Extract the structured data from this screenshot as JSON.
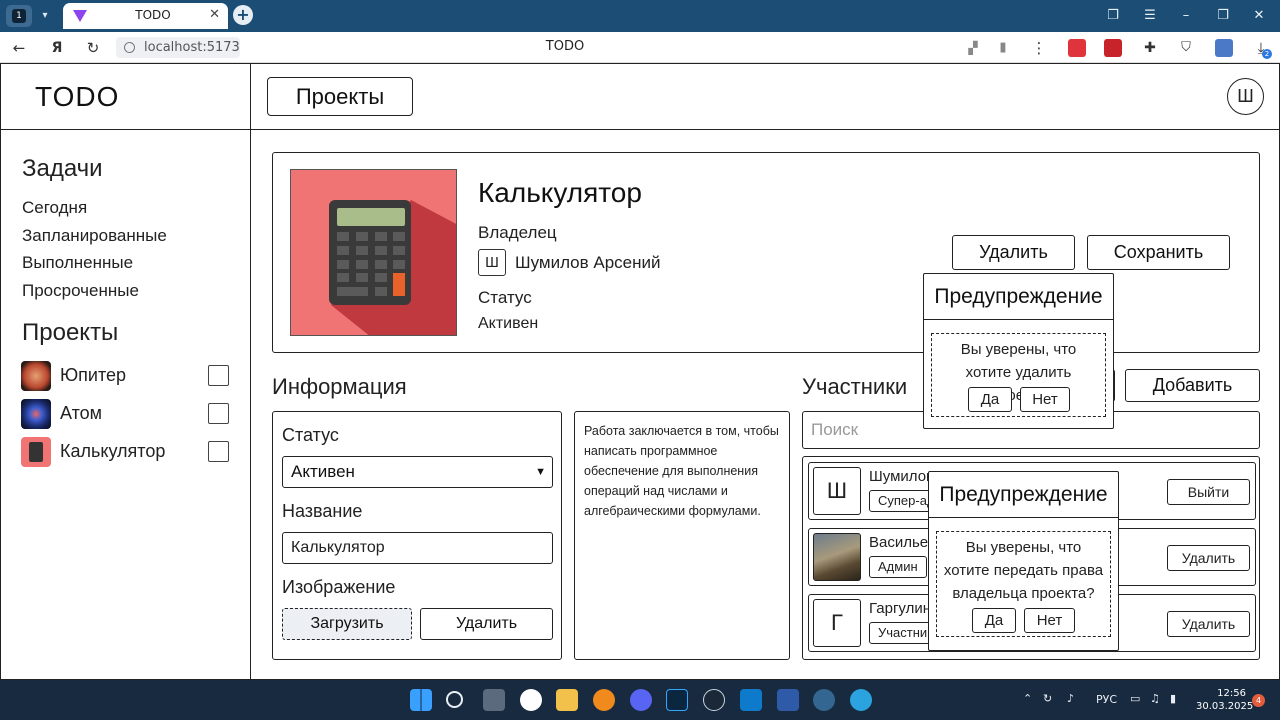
{
  "browser": {
    "workspace_label": "1",
    "tab_title": "TODO",
    "url": "localhost:5173",
    "page_title": "TODO",
    "download_count": "2"
  },
  "header": {
    "logo": "TODO",
    "projects_button": "Проекты",
    "user_initial": "Ш"
  },
  "sidebar": {
    "tasks_heading": "Задачи",
    "task_links": [
      "Сегодня",
      "Запланированные",
      "Выполненные",
      "Просроченные"
    ],
    "projects_heading": "Проекты",
    "projects": [
      {
        "name": "Юпитер",
        "color": "#b8472f"
      },
      {
        "name": "Атом",
        "color": "#1a2a6c"
      },
      {
        "name": "Калькулятор",
        "color": "#f07474"
      }
    ]
  },
  "project": {
    "title": "Калькулятор",
    "owner_label": "Владелец",
    "owner_initial": "Ш",
    "owner_name": "Шумилов Арсений",
    "status_label": "Статус",
    "status_value": "Активен",
    "delete_button": "Удалить",
    "save_button": "Сохранить"
  },
  "info": {
    "heading": "Информация",
    "status_label": "Статус",
    "status_selected": "Активен",
    "name_label": "Название",
    "name_value": "Калькулятор",
    "image_label": "Изображение",
    "upload_button": "Загрузить",
    "delete_button": "Удалить",
    "description": "Работа заключается в том, чтобы написать программное обеспечение для выполнения операций над числами и алгебраическими формулами."
  },
  "members": {
    "heading": "Участники",
    "add_button": "Добавить",
    "search_placeholder": "Поиск",
    "rows": [
      {
        "initial": "Ш",
        "name": "Шумилов",
        "role": "Супер-ад",
        "action": "Выйти"
      },
      {
        "initial": "",
        "name": "Васильев",
        "role": "Админ",
        "action": "Удалить"
      },
      {
        "initial": "Г",
        "name": "Гаргулин",
        "role": "Участник",
        "action": "Удалить"
      }
    ]
  },
  "dialogs": {
    "delete_project": {
      "title": "Предупреждение",
      "message": "Вы уверены, что хотите удалить проект?",
      "yes": "Да",
      "no": "Нет"
    },
    "transfer_owner": {
      "title": "Предупреждение",
      "message": "Вы уверены, что хотите передать права владельца проекта?",
      "yes": "Да",
      "no": "Нет"
    }
  },
  "taskbar": {
    "lang": "РУС",
    "time": "12:56",
    "date": "30.03.2025",
    "notifications": "4"
  }
}
